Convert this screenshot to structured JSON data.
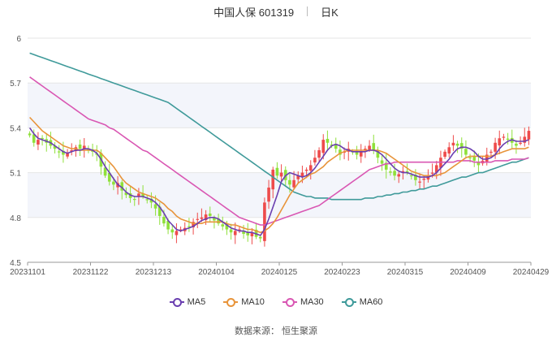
{
  "header": {
    "name_code": "中国人保 601319",
    "period": "日K"
  },
  "source": "数据来源： 恒生聚源",
  "colors": {
    "up": "#ee4b4b",
    "down": "#8fe03a",
    "ma5": "#6a3fb0",
    "ma10": "#e8943a",
    "ma30": "#d957b3",
    "ma60": "#3f9a9a",
    "band": "#f3f5fb",
    "grid": "#e6e6e6",
    "axis": "#999999",
    "text": "#555555"
  },
  "chart_data": {
    "type": "candlestick",
    "title": "中国人保 601319",
    "subtitle": "日K",
    "y_ticks": [
      "6",
      "5.7",
      "5.4",
      "5.1",
      "4.8",
      "4.5"
    ],
    "ylim": [
      4.5,
      6.0
    ],
    "x_ticks": [
      "20231101",
      "20231122",
      "20231213",
      "20240104",
      "20240125",
      "20240223",
      "20240315",
      "20240409",
      "20240429"
    ],
    "legend": [
      "MA5",
      "MA10",
      "MA30",
      "MA60"
    ],
    "closes": [
      5.35,
      5.3,
      5.32,
      5.33,
      5.3,
      5.28,
      5.26,
      5.24,
      5.22,
      5.23,
      5.25,
      5.27,
      5.26,
      5.28,
      5.25,
      5.24,
      5.22,
      5.14,
      5.08,
      5.04,
      5.02,
      5.03,
      4.98,
      4.95,
      4.93,
      4.92,
      4.96,
      4.94,
      4.92,
      4.9,
      4.86,
      4.81,
      4.76,
      4.72,
      4.7,
      4.71,
      4.72,
      4.73,
      4.74,
      4.77,
      4.79,
      4.8,
      4.82,
      4.81,
      4.78,
      4.76,
      4.74,
      4.72,
      4.7,
      4.71,
      4.72,
      4.69,
      4.68,
      4.7,
      4.67,
      4.66,
      4.9,
      5.0,
      5.12,
      5.08,
      5.1,
      5.05,
      5.02,
      5.05,
      5.08,
      5.1,
      5.12,
      5.15,
      5.2,
      5.25,
      5.32,
      5.3,
      5.28,
      5.26,
      5.22,
      5.24,
      5.26,
      5.24,
      5.22,
      5.24,
      5.26,
      5.28,
      5.25,
      5.2,
      5.16,
      5.12,
      5.1,
      5.08,
      5.09,
      5.11,
      5.1,
      5.08,
      5.05,
      5.04,
      5.06,
      5.08,
      5.1,
      5.15,
      5.2,
      5.24,
      5.27,
      5.3,
      5.28,
      5.26,
      5.22,
      5.2,
      5.18,
      5.15,
      5.18,
      5.22,
      5.24,
      5.3,
      5.33,
      5.34,
      5.32,
      5.3,
      5.28,
      5.3,
      5.34,
      5.38
    ],
    "ma5": [
      5.4,
      5.36,
      5.33,
      5.32,
      5.31,
      5.3,
      5.28,
      5.26,
      5.24,
      5.23,
      5.24,
      5.25,
      5.25,
      5.26,
      5.26,
      5.25,
      5.23,
      5.19,
      5.14,
      5.1,
      5.06,
      5.02,
      5.0,
      4.97,
      4.95,
      4.94,
      4.94,
      4.94,
      4.93,
      4.92,
      4.9,
      4.87,
      4.83,
      4.78,
      4.75,
      4.72,
      4.71,
      4.72,
      4.73,
      4.74,
      4.76,
      4.78,
      4.79,
      4.8,
      4.8,
      4.79,
      4.77,
      4.75,
      4.73,
      4.72,
      4.71,
      4.71,
      4.7,
      4.7,
      4.69,
      4.68,
      4.72,
      4.79,
      4.87,
      4.95,
      5.04,
      5.08,
      5.1,
      5.09,
      5.08,
      5.07,
      5.08,
      5.1,
      5.13,
      5.17,
      5.21,
      5.25,
      5.28,
      5.29,
      5.28,
      5.26,
      5.25,
      5.24,
      5.24,
      5.24,
      5.24,
      5.25,
      5.25,
      5.24,
      5.22,
      5.19,
      5.16,
      5.13,
      5.11,
      5.1,
      5.1,
      5.09,
      5.08,
      5.07,
      5.07,
      5.07,
      5.08,
      5.1,
      5.13,
      5.16,
      5.19,
      5.23,
      5.26,
      5.27,
      5.27,
      5.26,
      5.24,
      5.21,
      5.19,
      5.19,
      5.2,
      5.22,
      5.26,
      5.29,
      5.31,
      5.32,
      5.31,
      5.31,
      5.31,
      5.32
    ],
    "ma10": [
      5.47,
      5.44,
      5.41,
      5.38,
      5.36,
      5.34,
      5.32,
      5.3,
      5.28,
      5.27,
      5.26,
      5.26,
      5.25,
      5.25,
      5.25,
      5.25,
      5.25,
      5.23,
      5.2,
      5.17,
      5.14,
      5.1,
      5.06,
      5.03,
      5.01,
      4.99,
      4.97,
      4.96,
      4.95,
      4.94,
      4.93,
      4.91,
      4.89,
      4.86,
      4.84,
      4.81,
      4.79,
      4.78,
      4.77,
      4.76,
      4.76,
      4.76,
      4.77,
      4.77,
      4.77,
      4.77,
      4.77,
      4.76,
      4.75,
      4.75,
      4.74,
      4.73,
      4.72,
      4.72,
      4.71,
      4.7,
      4.71,
      4.73,
      4.76,
      4.8,
      4.85,
      4.9,
      4.95,
      4.99,
      5.03,
      5.05,
      5.07,
      5.09,
      5.1,
      5.12,
      5.14,
      5.17,
      5.19,
      5.21,
      5.23,
      5.24,
      5.25,
      5.25,
      5.25,
      5.25,
      5.25,
      5.25,
      5.25,
      5.25,
      5.24,
      5.23,
      5.21,
      5.19,
      5.17,
      5.15,
      5.13,
      5.11,
      5.1,
      5.09,
      5.08,
      5.08,
      5.08,
      5.08,
      5.09,
      5.1,
      5.12,
      5.14,
      5.16,
      5.18,
      5.2,
      5.21,
      5.21,
      5.21,
      5.21,
      5.21,
      5.21,
      5.22,
      5.23,
      5.24,
      5.25,
      5.26,
      5.26,
      5.26,
      5.26,
      5.27
    ],
    "ma30": [
      5.74,
      5.72,
      5.7,
      5.68,
      5.66,
      5.64,
      5.62,
      5.6,
      5.58,
      5.56,
      5.54,
      5.52,
      5.5,
      5.48,
      5.46,
      5.45,
      5.44,
      5.43,
      5.42,
      5.4,
      5.39,
      5.37,
      5.35,
      5.33,
      5.31,
      5.29,
      5.27,
      5.25,
      5.24,
      5.22,
      5.2,
      5.18,
      5.16,
      5.14,
      5.12,
      5.1,
      5.08,
      5.06,
      5.04,
      5.02,
      5.0,
      4.98,
      4.96,
      4.94,
      4.92,
      4.9,
      4.88,
      4.86,
      4.84,
      4.82,
      4.8,
      4.79,
      4.78,
      4.77,
      4.76,
      4.75,
      4.75,
      4.76,
      4.77,
      4.78,
      4.79,
      4.8,
      4.81,
      4.82,
      4.83,
      4.84,
      4.85,
      4.86,
      4.87,
      4.88,
      4.9,
      4.92,
      4.94,
      4.96,
      4.98,
      5.0,
      5.02,
      5.04,
      5.06,
      5.08,
      5.1,
      5.12,
      5.13,
      5.14,
      5.15,
      5.16,
      5.16,
      5.17,
      5.17,
      5.17,
      5.17,
      5.17,
      5.17,
      5.17,
      5.17,
      5.17,
      5.17,
      5.17,
      5.17,
      5.17,
      5.17,
      5.17,
      5.18,
      5.18,
      5.18,
      5.18,
      5.17,
      5.17,
      5.17,
      5.17,
      5.17,
      5.18,
      5.18,
      5.18,
      5.18,
      5.19,
      5.19,
      5.19,
      5.19,
      5.2
    ],
    "ma60": [
      5.9,
      5.89,
      5.88,
      5.87,
      5.86,
      5.85,
      5.84,
      5.83,
      5.82,
      5.81,
      5.8,
      5.79,
      5.78,
      5.77,
      5.76,
      5.75,
      5.74,
      5.73,
      5.72,
      5.71,
      5.7,
      5.69,
      5.68,
      5.67,
      5.66,
      5.65,
      5.64,
      5.63,
      5.62,
      5.61,
      5.6,
      5.59,
      5.58,
      5.57,
      5.55,
      5.53,
      5.51,
      5.49,
      5.47,
      5.45,
      5.43,
      5.41,
      5.39,
      5.37,
      5.35,
      5.33,
      5.31,
      5.29,
      5.27,
      5.25,
      5.23,
      5.21,
      5.19,
      5.17,
      5.15,
      5.13,
      5.11,
      5.09,
      5.07,
      5.05,
      5.03,
      5.01,
      4.99,
      4.97,
      4.96,
      4.95,
      4.94,
      4.94,
      4.93,
      4.93,
      4.93,
      4.93,
      4.92,
      4.92,
      4.92,
      4.92,
      4.92,
      4.92,
      4.92,
      4.92,
      4.93,
      4.93,
      4.93,
      4.94,
      4.94,
      4.95,
      4.95,
      4.96,
      4.96,
      4.97,
      4.97,
      4.98,
      4.98,
      4.99,
      4.99,
      5.0,
      5.01,
      5.01,
      5.02,
      5.03,
      5.04,
      5.05,
      5.06,
      5.07,
      5.07,
      5.08,
      5.09,
      5.1,
      5.1,
      5.11,
      5.12,
      5.13,
      5.14,
      5.15,
      5.16,
      5.17,
      5.17,
      5.18,
      5.19,
      5.2
    ]
  }
}
